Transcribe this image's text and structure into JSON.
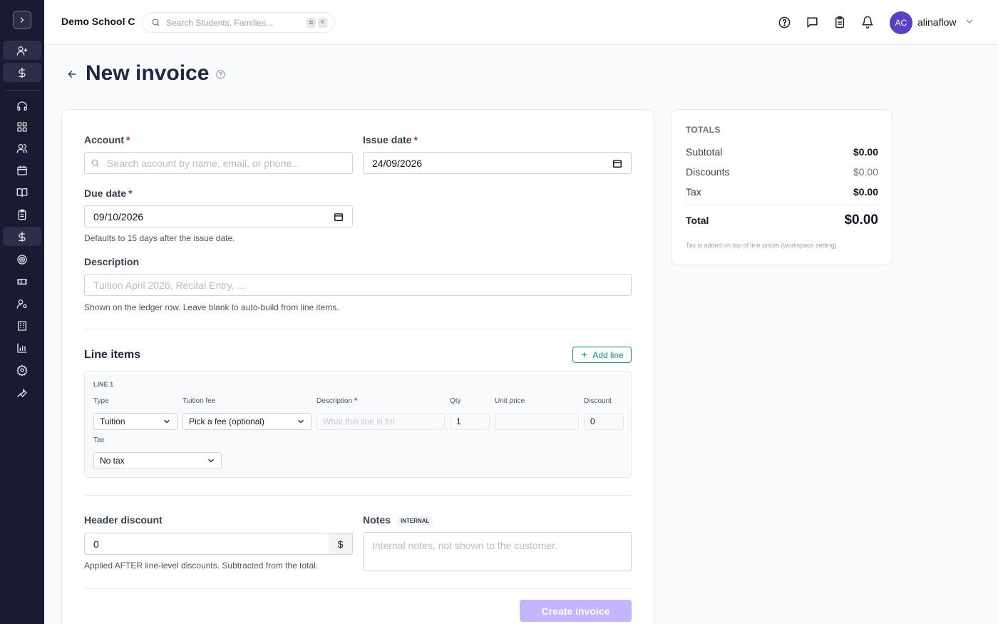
{
  "header": {
    "school_name": "Demo School C",
    "search_placeholder": "Search Students, Families...",
    "kbd_keys": [
      "⌘",
      "K"
    ],
    "user_initials": "AC",
    "username": "alinaflow"
  },
  "page": {
    "title": "New invoice"
  },
  "form": {
    "account_label": "Account",
    "account_placeholder": "Search account by name, email, or phone...",
    "issue_date_label": "Issue date",
    "issue_date_value": "24/09/2026",
    "due_date_label": "Due date",
    "due_date_value": "09/10/2026",
    "due_date_hint": "Defaults to 15 days after the issue date.",
    "description_label": "Description",
    "description_placeholder": "Tuition April 2026, Recital Entry, ...",
    "description_hint": "Shown on the ledger row. Leave blank to auto-build from line items.",
    "required_marker": "*"
  },
  "line_items": {
    "section_title": "Line items",
    "add_line_label": "Add line",
    "line_title": "LINE 1",
    "type_label": "Type",
    "type_value": "Tuition",
    "fee_label": "Tuition fee",
    "fee_value": "Pick a fee (optional)",
    "desc_label": "Description",
    "desc_placeholder": "What this line is for",
    "qty_label": "Qty",
    "qty_value": "1",
    "unit_price_label": "Unit price",
    "unit_price_value": "",
    "discount_label": "Discount",
    "discount_value": "0",
    "tax_label": "Tax",
    "tax_value": "No tax"
  },
  "footer_form": {
    "header_discount_label": "Header discount",
    "header_discount_value": "0",
    "currency_symbol": "$",
    "header_discount_hint": "Applied AFTER line-level discounts. Subtracted from the total.",
    "notes_label": "Notes",
    "notes_badge": "INTERNAL",
    "notes_placeholder": "Internal notes, not shown to the customer.",
    "create_button": "Create invoice"
  },
  "totals": {
    "heading": "TOTALS",
    "subtotal_label": "Subtotal",
    "subtotal_value": "$0.00",
    "discounts_label": "Discounts",
    "discounts_value": "$0.00",
    "tax_label": "Tax",
    "tax_value": "$0.00",
    "total_label": "Total",
    "total_value": "$0.00",
    "note": "Tax is added on top of line prices (workspace setting)."
  },
  "colors": {
    "sidebar_bg": "#1a1a33",
    "accent_purple": "#5b3fc4",
    "teal": "#0f9b94",
    "required_red": "#dc2626",
    "disabled_button": "#c4b5fd"
  },
  "icons": {
    "sidebar": [
      "chevron-right-icon",
      "user-plus-icon",
      "dollar-icon",
      "headset-icon",
      "grid-icon",
      "users-icon",
      "calendar-icon",
      "book-icon",
      "clipboard-icon",
      "dollar-icon",
      "target-icon",
      "ticket-icon",
      "user-cog-icon",
      "building-icon",
      "chart-icon",
      "settings-icon",
      "wrench-icon"
    ],
    "topbar": [
      "help-icon",
      "chat-icon",
      "clipboard-icon",
      "bell-icon"
    ]
  }
}
